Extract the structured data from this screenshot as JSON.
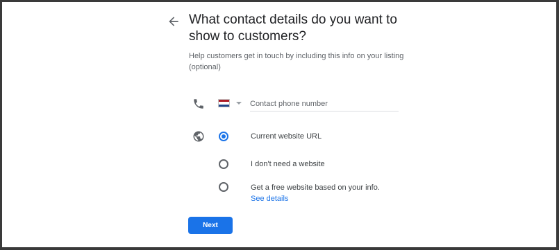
{
  "header": {
    "title": "What contact details do you want to show to customers?",
    "subtitle": "Help customers get in touch by including this info on your listing (optional)",
    "back_icon": "arrow-back-icon"
  },
  "phone": {
    "icon": "phone-icon",
    "country_flag": "netherlands-flag",
    "flag_colors": [
      "#ae1c28",
      "#ffffff",
      "#21468b"
    ],
    "input_value": "",
    "input_placeholder": "Contact phone number"
  },
  "website": {
    "icon": "globe-icon",
    "selected_option": "current_url",
    "options": [
      {
        "id": "current_url",
        "label": "Current website URL",
        "checked": true
      },
      {
        "id": "no_website",
        "label": "I don't need a website",
        "checked": false
      },
      {
        "id": "free_website",
        "label": "Get a free website based on your info.",
        "checked": false
      }
    ],
    "details_link": "See details"
  },
  "actions": {
    "next_label": "Next"
  },
  "colors": {
    "accent": "#1a73e8",
    "text_primary": "#202124",
    "text_secondary": "#5f6368",
    "divider": "#dadce0",
    "frame": "#3a3a3a"
  }
}
